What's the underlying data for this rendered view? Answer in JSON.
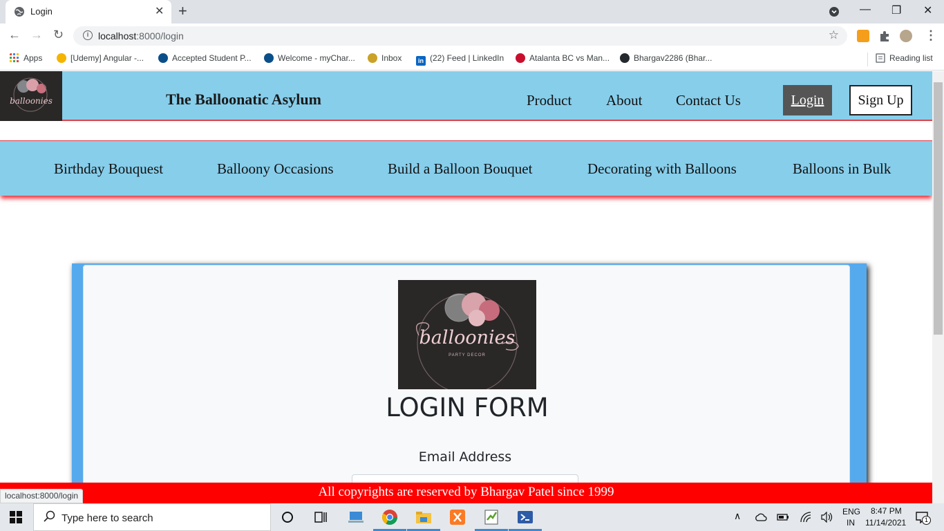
{
  "browser": {
    "tab_title": "Login",
    "close_glyph": "✕",
    "newtab_glyph": "+",
    "window_controls": [
      "—",
      "❐",
      "✕"
    ],
    "back_glyph": "←",
    "forward_glyph": "→",
    "reload_glyph": "↻",
    "info_glyph": "i",
    "url_host": "localhost",
    "url_path": ":8000/login",
    "star_glyph": "☆",
    "menu_glyph": "⋮",
    "bookmarks": [
      {
        "label": "Apps",
        "color": "#e94235"
      },
      {
        "label": "[Udemy] Angular -...",
        "color": "#f4b400"
      },
      {
        "label": "Accepted Student P...",
        "color": "#0b4f8a"
      },
      {
        "label": "Welcome - myChar...",
        "color": "#0b4f8a"
      },
      {
        "label": "Inbox",
        "color": "#c9a227"
      },
      {
        "label": "(22) Feed | LinkedIn",
        "color": "#0a66c2"
      },
      {
        "label": "Atalanta BC vs Man...",
        "color": "#c8102e"
      },
      {
        "label": "Bhargav2286 (Bhar...",
        "color": "#24292e"
      }
    ],
    "reading_list": "Reading list"
  },
  "site": {
    "title": "The Balloonatic Asylum",
    "nav": [
      "Product",
      "About",
      "Contact Us"
    ],
    "login": "Login",
    "signup": "Sign Up",
    "categories": [
      "Birthday Bouquest",
      "Balloony Occasions",
      "Build a Balloon Bouquet",
      "Decorating with Balloons",
      "Balloons in Bulk"
    ],
    "logo_text": "balloonies",
    "logo_subtext": "PARTY DECOR"
  },
  "form": {
    "title": "LOGIN FORM",
    "email_label": "Email Address",
    "email_value": ""
  },
  "footer": {
    "text": "All copyrights are reserved by Bhargav Patel since 1999"
  },
  "status_url": "localhost:8000/login",
  "taskbar": {
    "search_placeholder": "Type here to search",
    "lang_top": "ENG",
    "lang_bottom": "IN",
    "time": "8:47 PM",
    "date": "11/14/2021",
    "notification_count": "1"
  },
  "colors": {
    "nav_bg": "#87ceeb",
    "accent_red": "#ff0000",
    "card_accent": "#55aaee",
    "login_bg": "#555555"
  }
}
